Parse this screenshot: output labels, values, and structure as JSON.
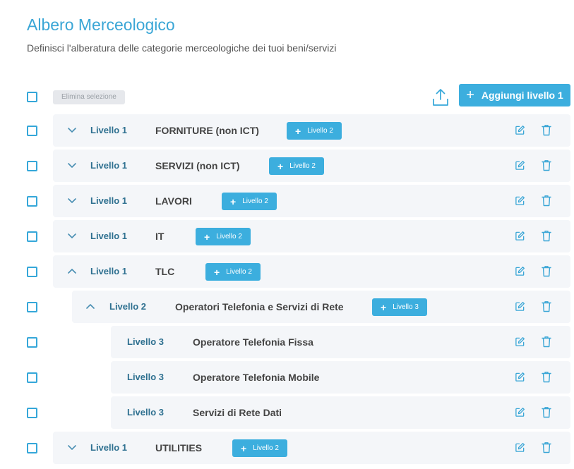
{
  "header": {
    "title": "Albero Merceologico",
    "subtitle": "Definisci l'alberatura delle categorie merceologiche dei tuoi beni/servizi"
  },
  "toolbar": {
    "delete_selection_label": "Elimina selezione",
    "upload_icon": "upload-icon",
    "add_level1_label": "Aggiungi livello 1",
    "add_level1_icon": "+"
  },
  "accent_color": "#3caede",
  "rows": [
    {
      "level": "Livello 1",
      "name": "FORNITURE (non ICT)",
      "chevron": "down",
      "add_label": "Livello 2"
    },
    {
      "level": "Livello 1",
      "name": "SERVIZI (non ICT)",
      "chevron": "down",
      "add_label": "Livello 2"
    },
    {
      "level": "Livello 1",
      "name": "LAVORI",
      "chevron": "down",
      "add_label": "Livello 2"
    },
    {
      "level": "Livello 1",
      "name": "IT",
      "chevron": "down",
      "add_label": "Livello 2"
    },
    {
      "level": "Livello 1",
      "name": "TLC",
      "chevron": "up",
      "add_label": "Livello 2"
    },
    {
      "level": "Livello 2",
      "name": "Operatori Telefonia e Servizi di Rete",
      "chevron": "up",
      "add_label": "Livello 3"
    },
    {
      "level": "Livello 3",
      "name": "Operatore Telefonia Fissa"
    },
    {
      "level": "Livello 3",
      "name": "Operatore Telefonia Mobile"
    },
    {
      "level": "Livello 3",
      "name": "Servizi di Rete Dati"
    },
    {
      "level": "Livello 1",
      "name": "UTILITIES",
      "chevron": "down",
      "add_label": "Livello 2"
    }
  ]
}
